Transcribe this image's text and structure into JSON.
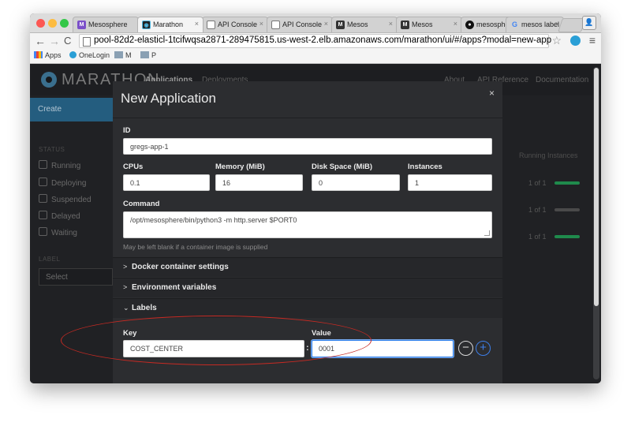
{
  "browser": {
    "tabs": [
      {
        "title": "Mesosphere",
        "icon": "mesosphere-favicon"
      },
      {
        "title": "Marathon",
        "icon": "marathon-favicon"
      },
      {
        "title": "API Console",
        "icon": "page-icon"
      },
      {
        "title": "API Console",
        "icon": "page-icon"
      },
      {
        "title": "Mesos",
        "icon": "mesos-favicon"
      },
      {
        "title": "Mesos",
        "icon": "mesos-favicon"
      },
      {
        "title": "mesosphere",
        "icon": "github-icon"
      },
      {
        "title": "mesos label",
        "icon": "google-icon"
      }
    ],
    "url": "pool-82d2-elasticl-1tcifwqsa2871-289475815.us-west-2.elb.amazonaws.com/marathon/ui/#/apps?modal=new-app",
    "bookmarks": [
      "Apps",
      "OneLogin",
      "M",
      "P"
    ]
  },
  "app": {
    "logo": "MARATHON",
    "nav": {
      "applications": "Applications",
      "deployments": "Deployments",
      "about": "About",
      "api_reference": "API Reference",
      "documentation": "Documentation"
    },
    "create": "Create",
    "status_heading": "STATUS",
    "statuses": [
      "Running",
      "Deploying",
      "Suspended",
      "Delayed",
      "Waiting"
    ],
    "label_heading": "LABEL",
    "label_select": "Select",
    "running_instances": "Running Instances",
    "instance_rows": [
      {
        "text": "1 of 1",
        "color": "#1f8a4c"
      },
      {
        "text": "1 of 1",
        "color": "#4a4a4a"
      },
      {
        "text": "1 of 1",
        "color": "#1f8a4c"
      }
    ]
  },
  "modal": {
    "title": "New Application",
    "close": "×",
    "id_label": "ID",
    "id_value": "gregs-app-1",
    "cpus_label": "CPUs",
    "cpus_value": "0.1",
    "memory_label": "Memory (MiB)",
    "memory_value": "16",
    "disk_label": "Disk Space (MiB)",
    "disk_value": "0",
    "instances_label": "Instances",
    "instances_value": "1",
    "command_label": "Command",
    "command_value": "/opt/mesosphere/bin/python3 -m http.server $PORT0",
    "command_help": "May be left blank if a container image is supplied",
    "sections": {
      "docker": "Docker container settings",
      "env": "Environment variables",
      "labels": "Labels"
    },
    "labels": {
      "key_label": "Key",
      "value_label": "Value",
      "key_value": "COST_CENTER",
      "value_value": "0001",
      "separator": ":"
    }
  },
  "colors": {
    "annotation": "#c62a23",
    "accent": "#2c7ce6",
    "create_button": "#245d7f"
  }
}
